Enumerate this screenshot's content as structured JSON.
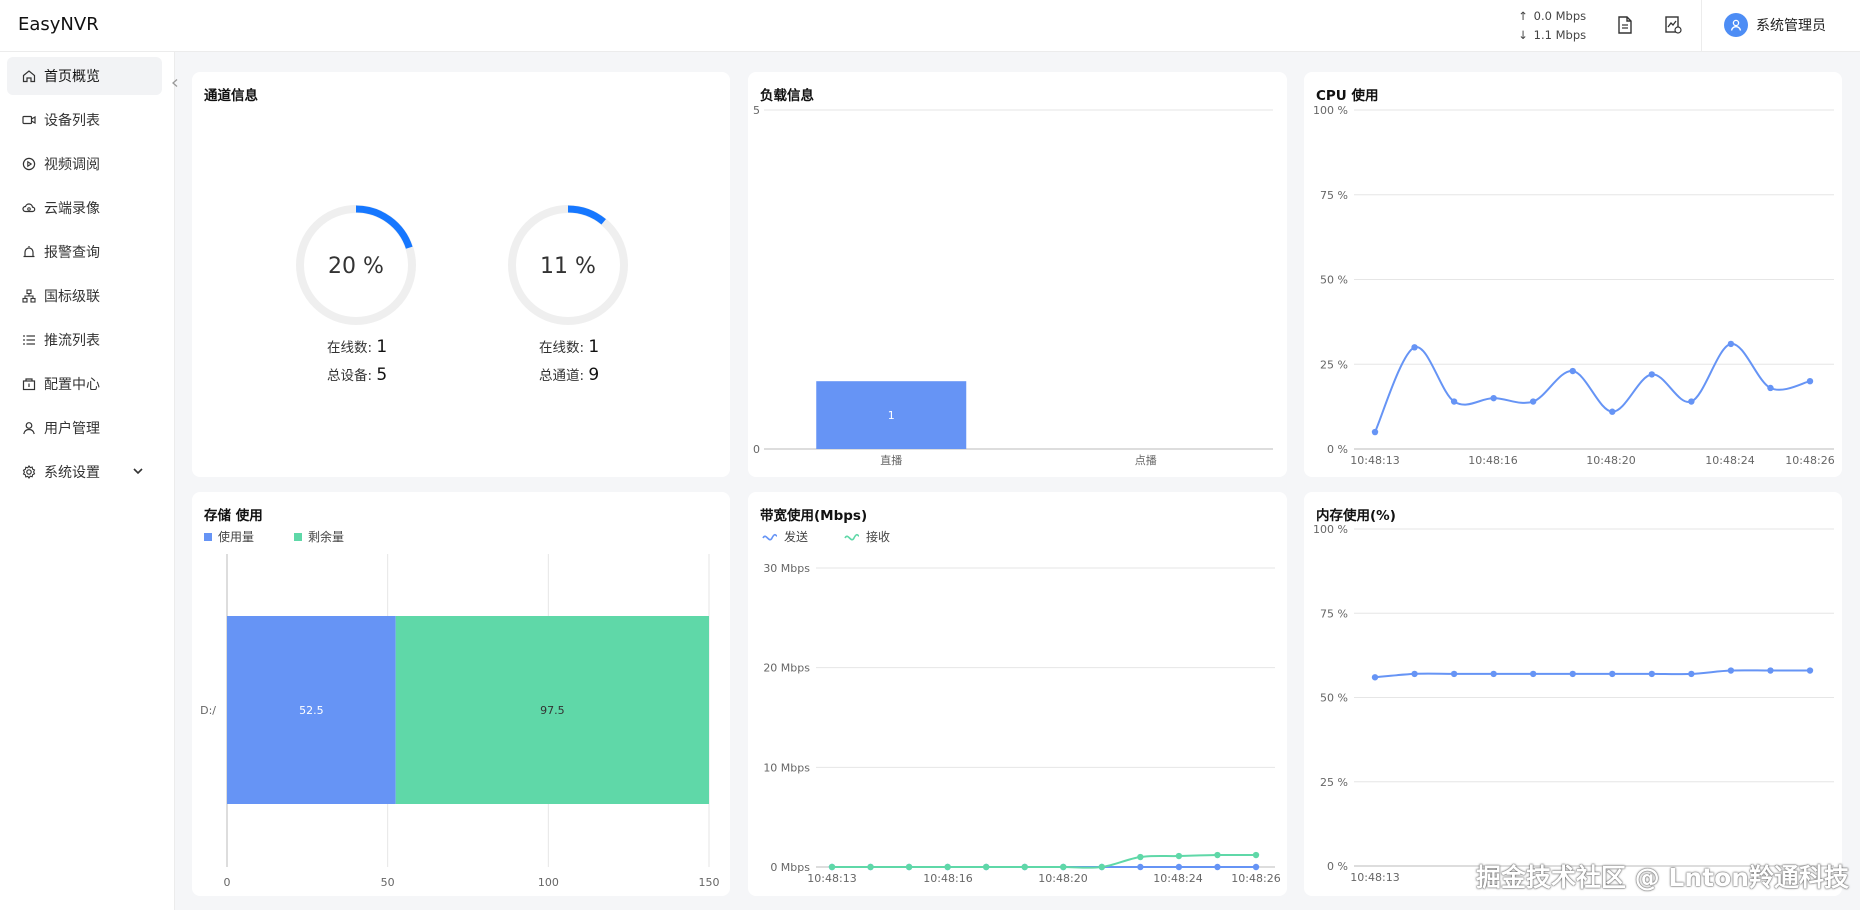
{
  "app": {
    "title": "EasyNVR"
  },
  "header": {
    "upload": "0.0 Mbps",
    "download": "1.1 Mbps",
    "icons": [
      "document-icon",
      "device-chart-icon"
    ],
    "user": "系统管理员"
  },
  "sidebar": {
    "items": [
      {
        "label": "首页概览",
        "icon": "home-icon",
        "active": true
      },
      {
        "label": "设备列表",
        "icon": "video-camera-icon"
      },
      {
        "label": "视频调阅",
        "icon": "play-circle-icon"
      },
      {
        "label": "云端录像",
        "icon": "cloud-video-icon"
      },
      {
        "label": "报警查询",
        "icon": "alarm-icon"
      },
      {
        "label": "国标级联",
        "icon": "cascade-icon"
      },
      {
        "label": "推流列表",
        "icon": "list-icon"
      },
      {
        "label": "配置中心",
        "icon": "config-icon"
      },
      {
        "label": "用户管理",
        "icon": "user-icon"
      },
      {
        "label": "系统设置",
        "icon": "gear-icon"
      }
    ]
  },
  "channel": {
    "title": "通道信息",
    "gauges": [
      {
        "percent_label": "20 %",
        "value": 0.2,
        "line1_label": "在线数:",
        "line1_value": "1",
        "line2_label": "总设备:",
        "line2_value": "5"
      },
      {
        "percent_label": "11 %",
        "value": 0.11,
        "line1_label": "在线数:",
        "line1_value": "1",
        "line2_label": "总通道:",
        "line2_value": "9"
      }
    ]
  },
  "colors": {
    "blue": "#6694f5",
    "green": "#5fd8a8",
    "grid": "#e6e6e6",
    "accent": "#1677ff"
  },
  "chart_data": [
    {
      "id": "load",
      "type": "bar",
      "title": "负载信息",
      "categories": [
        "直播",
        "点播"
      ],
      "values": [
        1,
        0
      ],
      "ylim": [
        0,
        5
      ],
      "yticks": [
        "0",
        "5"
      ]
    },
    {
      "id": "cpu",
      "type": "line",
      "title": "CPU 使用",
      "x": [
        "10:48:13",
        "10:48:14",
        "10:48:15",
        "10:48:16",
        "10:48:17",
        "10:48:18",
        "10:48:19",
        "10:48:20",
        "10:48:21",
        "10:48:22",
        "10:48:23",
        "10:48:24",
        "10:48:25",
        "10:48:26"
      ],
      "xticks": [
        "10:48:13",
        "10:48:16",
        "10:48:20",
        "10:48:24",
        "10:48:26"
      ],
      "values": [
        5,
        30,
        14,
        15,
        14,
        23,
        11,
        22,
        14,
        31,
        18,
        20
      ],
      "ylim": [
        0,
        100
      ],
      "yticks": [
        "0 %",
        "25 %",
        "50 %",
        "75 %",
        "100 %"
      ]
    },
    {
      "id": "storage",
      "type": "bar",
      "title": "存储 使用",
      "categories": [
        "D:/"
      ],
      "series": [
        {
          "name": "使用量",
          "values": [
            52.5
          ]
        },
        {
          "name": "剩余量",
          "values": [
            97.5
          ]
        }
      ],
      "xlim": [
        0,
        150
      ],
      "xticks": [
        "0",
        "50",
        "100",
        "150"
      ]
    },
    {
      "id": "bandwidth",
      "type": "line",
      "title": "带宽使用(Mbps)",
      "xticks": [
        "10:48:13",
        "10:48:16",
        "10:48:20",
        "10:48:24",
        "10:48:26"
      ],
      "series": [
        {
          "name": "发送",
          "values": [
            0,
            0,
            0,
            0,
            0,
            0,
            0,
            0,
            0,
            0,
            0,
            0
          ]
        },
        {
          "name": "接收",
          "values": [
            0,
            0,
            0,
            0,
            0,
            0,
            0,
            0,
            1,
            1.1,
            1.2,
            1.2
          ]
        }
      ],
      "ylim": [
        0,
        30
      ],
      "yticks": [
        "0 Mbps",
        "10 Mbps",
        "20 Mbps",
        "30 Mbps"
      ]
    },
    {
      "id": "memory",
      "type": "line",
      "title": "内存使用(%)",
      "xticks": [
        "10:48:13"
      ],
      "values": [
        56,
        57,
        57,
        57,
        57,
        57,
        57,
        57,
        57,
        58,
        58,
        58
      ],
      "ylim": [
        0,
        100
      ],
      "yticks": [
        "0 %",
        "25 %",
        "50 %",
        "75 %",
        "100 %"
      ]
    }
  ],
  "watermark": "掘金技术社区 @ Lnton羚通科技"
}
